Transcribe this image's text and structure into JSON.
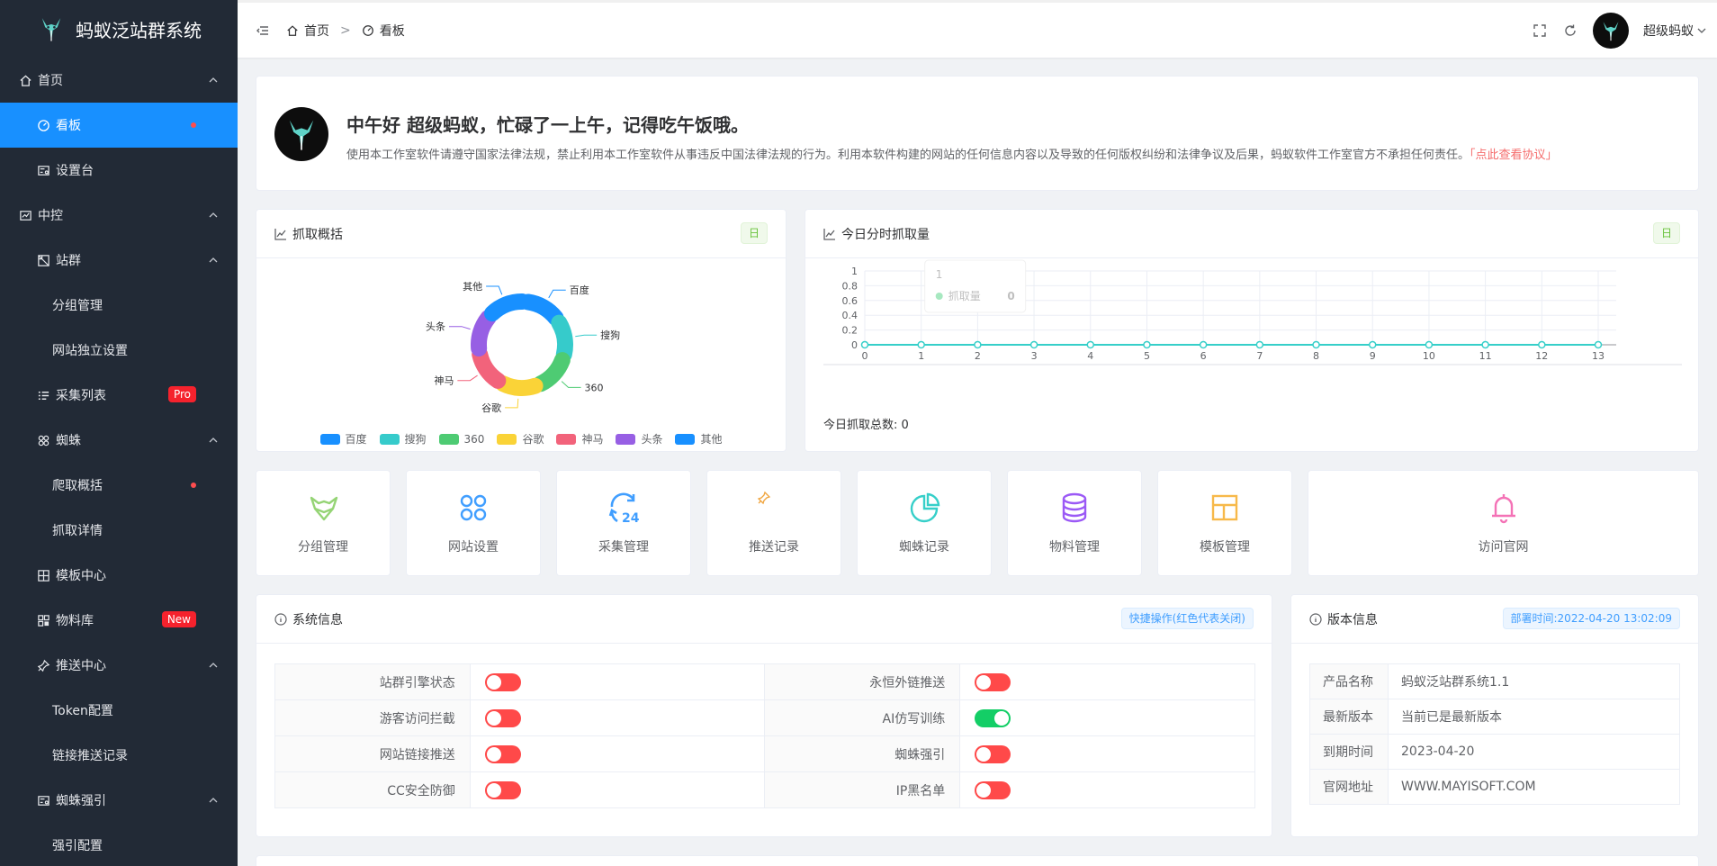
{
  "app": {
    "title": "蚂蚁泛站群系统"
  },
  "sidebar": {
    "items": [
      {
        "label": "首页",
        "icon": "home-icon",
        "level": 0,
        "caret": true
      },
      {
        "label": "看板",
        "icon": "dashboard-icon",
        "level": 1,
        "active": true,
        "dot": true
      },
      {
        "label": "设置台",
        "icon": "settings-panel-icon",
        "level": 1
      },
      {
        "label": "中控",
        "icon": "monitor-icon",
        "level": 0,
        "caret": true
      },
      {
        "label": "站群",
        "icon": "sites-icon",
        "level": 1,
        "caret": true
      },
      {
        "label": "分组管理",
        "level": 2
      },
      {
        "label": "网站独立设置",
        "level": 2
      },
      {
        "label": "采集列表",
        "icon": "list-icon",
        "level": 1,
        "badge": "Pro"
      },
      {
        "label": "蜘蛛",
        "icon": "spider-icon",
        "level": 1,
        "caret": true
      },
      {
        "label": "爬取概括",
        "level": 2,
        "dot": true
      },
      {
        "label": "抓取详情",
        "level": 2
      },
      {
        "label": "模板中心",
        "icon": "grid-icon",
        "level": 1
      },
      {
        "label": "物料库",
        "icon": "tiles-icon",
        "level": 1,
        "badge": "New"
      },
      {
        "label": "推送中心",
        "icon": "pin-icon",
        "level": 1,
        "caret": true
      },
      {
        "label": "Token配置",
        "level": 2
      },
      {
        "label": "链接推送记录",
        "level": 2
      },
      {
        "label": "蜘蛛强引",
        "icon": "settings-panel-icon",
        "level": 1,
        "caret": true
      },
      {
        "label": "强引配置",
        "level": 2
      }
    ]
  },
  "topbar": {
    "breadcrumb": [
      {
        "label": "首页"
      },
      {
        "label": "看板"
      }
    ],
    "separator": ">",
    "user": "超级蚂蚁"
  },
  "welcome": {
    "title": "中午好 超级蚂蚁，忙碌了一上午，记得吃午饭哦。",
    "desc": "使用本工作室软件请遵守国家法律法规，禁止利用本工作室软件从事违反中国法律法规的行为。利用本软件构建的网站的任何信息内容以及导致的任何版权纠纷和法律争议及后果，蚂蚁软件工作室官方不承担任何责任。",
    "link": "「点此查看协议」"
  },
  "crawl_overview": {
    "title": "抓取概括",
    "tag": "日"
  },
  "hourly": {
    "title": "今日分时抓取量",
    "tag": "日",
    "total_label": "今日抓取总数: 0"
  },
  "quick_links": [
    {
      "label": "分组管理",
      "icon": "fox-icon",
      "color": "#95d475"
    },
    {
      "label": "网站设置",
      "icon": "clover-icon",
      "color": "#409eff"
    },
    {
      "label": "采集管理",
      "icon": "refresh-24-icon",
      "color": "#409eff"
    },
    {
      "label": "推送记录",
      "icon": "pin-icon",
      "color": "#f0a43c"
    },
    {
      "label": "蜘蛛记录",
      "icon": "pie-icon",
      "color": "#36cfc9"
    },
    {
      "label": "物料管理",
      "icon": "database-icon",
      "color": "#9b59f6"
    },
    {
      "label": "模板管理",
      "icon": "window-icon",
      "color": "#f7b94a"
    },
    {
      "label": "访问官网",
      "icon": "bell-icon",
      "color": "#f472b6"
    }
  ],
  "system_info": {
    "title": "系统信息",
    "tag": "快捷操作(红色代表关闭)",
    "rows": [
      [
        {
          "label": "站群引擎状态",
          "on": false
        },
        {
          "label": "永恒外链推送",
          "on": false
        }
      ],
      [
        {
          "label": "游客访问拦截",
          "on": false
        },
        {
          "label": "AI仿写训练",
          "on": true
        }
      ],
      [
        {
          "label": "网站链接推送",
          "on": false
        },
        {
          "label": "蜘蛛强引",
          "on": false
        }
      ],
      [
        {
          "label": "CC安全防御",
          "on": false
        },
        {
          "label": "IP黑名单",
          "on": false
        }
      ]
    ]
  },
  "version_info": {
    "title": "版本信息",
    "tag": "部署时间:2022-04-20 13:02:09",
    "rows": [
      {
        "label": "产品名称",
        "value": "蚂蚁泛站群系统1.1"
      },
      {
        "label": "最新版本",
        "value": "当前已是最新版本"
      },
      {
        "label": "到期时间",
        "value": "2023-04-20"
      },
      {
        "label": "官网地址",
        "value": "WWW.MAYISOFT.COM"
      }
    ]
  },
  "chart_data": [
    {
      "type": "pie",
      "variant": "ring",
      "categories": [
        "百度",
        "搜狗",
        "360",
        "谷歌",
        "神马",
        "头条",
        "其他"
      ],
      "values": [
        1,
        1,
        1,
        1,
        1,
        1,
        1
      ],
      "colors": [
        "#1890ff",
        "#36cbcb",
        "#4ecb73",
        "#fad337",
        "#f2637b",
        "#975fe4",
        "#1890ff"
      ],
      "legend": "bottom"
    },
    {
      "type": "line",
      "x": [
        0,
        1,
        2,
        3,
        4,
        5,
        6,
        7,
        8,
        9,
        10,
        11,
        12,
        13
      ],
      "series": [
        {
          "name": "抓取量",
          "values": [
            0,
            0,
            0,
            0,
            0,
            0,
            0,
            0,
            0,
            0,
            0,
            0,
            0,
            0
          ]
        }
      ],
      "yticks": [
        0,
        0.2,
        0.4,
        0.6,
        0.8,
        1
      ],
      "ylim": [
        0,
        1
      ],
      "grid": true,
      "color": "#36cfc9",
      "tooltip": {
        "title": "1",
        "series": "抓取量",
        "value": "0"
      }
    }
  ]
}
